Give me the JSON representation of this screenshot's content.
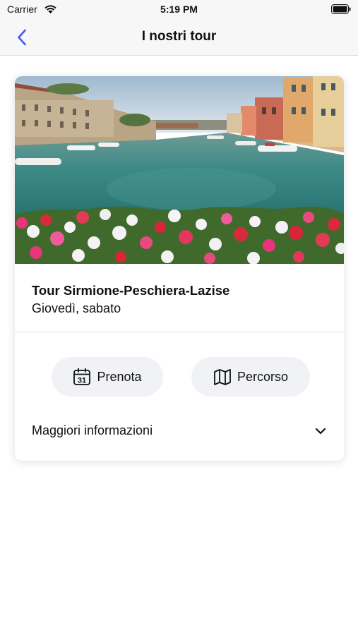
{
  "status_bar": {
    "carrier": "Carrier",
    "time": "5:19 PM",
    "icons": [
      "wifi-icon",
      "battery-icon"
    ]
  },
  "nav": {
    "title": "I nostri tour",
    "back_icon": "chevron-left-icon",
    "accent_color": "#4a5ee8"
  },
  "tour_card": {
    "image": "lake-canal-with-flowers-photo",
    "title": "Tour Sirmione-Peschiera-Lazise",
    "days": "Giovedì, sabato",
    "actions": {
      "book": {
        "label": "Prenota",
        "icon": "calendar-icon",
        "icon_number": "31"
      },
      "route": {
        "label": "Percorso",
        "icon": "map-icon"
      }
    },
    "more_info": {
      "label": "Maggiori informazioni",
      "icon": "chevron-down-icon"
    }
  }
}
